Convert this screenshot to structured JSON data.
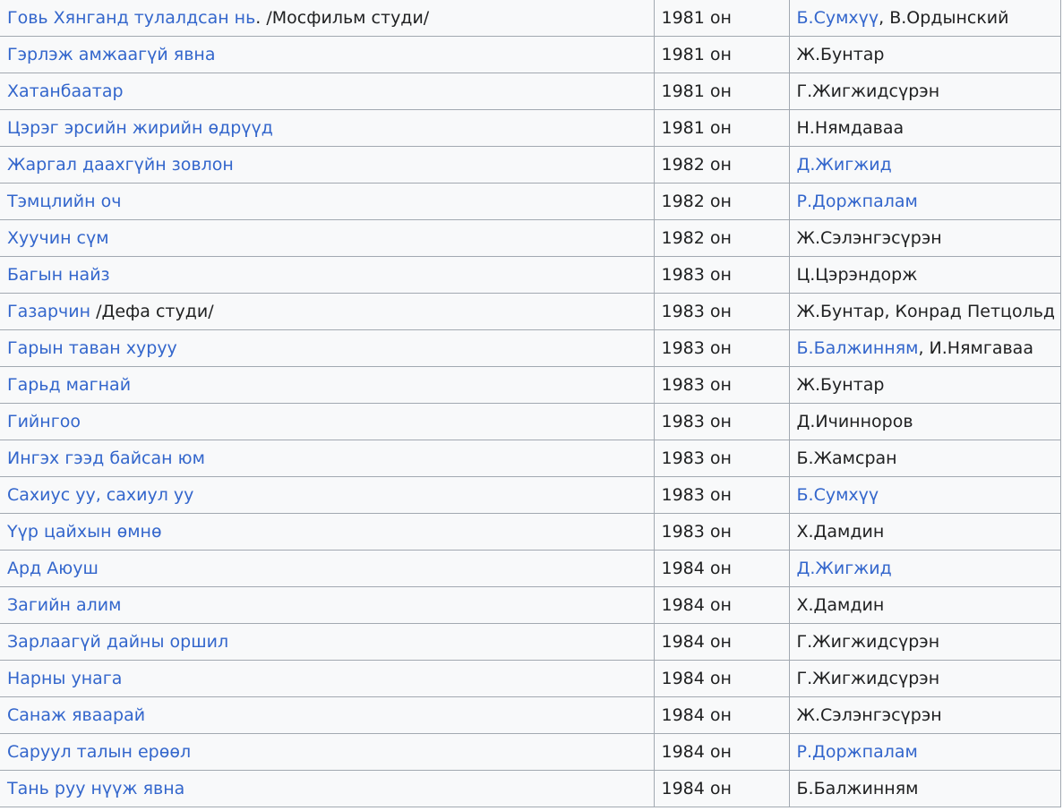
{
  "films": [
    {
      "title": [
        {
          "text": "Говь Хянганд тулалдсан нь",
          "link": true
        },
        {
          "text": ". /Мосфильм студи/",
          "link": false
        }
      ],
      "year": "1981 он",
      "director": [
        {
          "text": "Б.Сумхүү",
          "link": true
        },
        {
          "text": ", В.Ордынский",
          "link": false
        }
      ]
    },
    {
      "title": [
        {
          "text": "Гэрлэж амжаагүй явна",
          "link": true
        }
      ],
      "year": "1981 он",
      "director": [
        {
          "text": "Ж.Бунтар",
          "link": false
        }
      ]
    },
    {
      "title": [
        {
          "text": "Хатанбаатар",
          "link": true
        }
      ],
      "year": "1981 он",
      "director": [
        {
          "text": "Г.Жигжидсүрэн",
          "link": false
        }
      ]
    },
    {
      "title": [
        {
          "text": "Цэрэг эрсийн жирийн өдрүүд",
          "link": true
        }
      ],
      "year": "1981 он",
      "director": [
        {
          "text": "Н.Нямдаваа",
          "link": false
        }
      ]
    },
    {
      "title": [
        {
          "text": "Жаргал даахгүйн зовлон",
          "link": true
        }
      ],
      "year": "1982 он",
      "director": [
        {
          "text": "Д.Жигжид",
          "link": true
        }
      ]
    },
    {
      "title": [
        {
          "text": "Тэмцлийн оч",
          "link": true
        }
      ],
      "year": "1982 он",
      "director": [
        {
          "text": "Р.Доржпалам",
          "link": true
        }
      ]
    },
    {
      "title": [
        {
          "text": "Хуучин сүм",
          "link": true
        }
      ],
      "year": "1982 он",
      "director": [
        {
          "text": "Ж.Сэлэнгэсүрэн",
          "link": false
        }
      ]
    },
    {
      "title": [
        {
          "text": "Багын найз",
          "link": true
        }
      ],
      "year": "1983 он",
      "director": [
        {
          "text": "Ц.Цэрэндорж",
          "link": false
        }
      ]
    },
    {
      "title": [
        {
          "text": "Газарчин",
          "link": true
        },
        {
          "text": " /Дефа студи/",
          "link": false
        }
      ],
      "year": "1983 он",
      "director": [
        {
          "text": "Ж.Бунтар, Конрад Петцольд",
          "link": false
        }
      ]
    },
    {
      "title": [
        {
          "text": "Гарын таван хуруу",
          "link": true
        }
      ],
      "year": "1983 он",
      "director": [
        {
          "text": "Б.Балжинням",
          "link": true
        },
        {
          "text": ", И.Нямгаваа",
          "link": false
        }
      ]
    },
    {
      "title": [
        {
          "text": "Гарьд магнай",
          "link": true
        }
      ],
      "year": "1983 он",
      "director": [
        {
          "text": "Ж.Бунтар",
          "link": false
        }
      ]
    },
    {
      "title": [
        {
          "text": "Гийнгоо",
          "link": true
        }
      ],
      "year": "1983 он",
      "director": [
        {
          "text": "Д.Ичинноров",
          "link": false
        }
      ]
    },
    {
      "title": [
        {
          "text": "Ингэх гээд байсан юм",
          "link": true
        }
      ],
      "year": "1983 он",
      "director": [
        {
          "text": "Б.Жамсран",
          "link": false
        }
      ]
    },
    {
      "title": [
        {
          "text": "Сахиус уу, сахиул уу",
          "link": true
        }
      ],
      "year": "1983 он",
      "director": [
        {
          "text": "Б.Сумхүү",
          "link": true
        }
      ]
    },
    {
      "title": [
        {
          "text": "Үүр цайхын өмнө",
          "link": true
        }
      ],
      "year": "1983 он",
      "director": [
        {
          "text": "Х.Дамдин",
          "link": false
        }
      ]
    },
    {
      "title": [
        {
          "text": "Ард Аюуш",
          "link": true
        }
      ],
      "year": "1984 он",
      "director": [
        {
          "text": "Д.Жигжид",
          "link": true
        }
      ]
    },
    {
      "title": [
        {
          "text": "Загийн алим",
          "link": true
        }
      ],
      "year": "1984 он",
      "director": [
        {
          "text": "Х.Дамдин",
          "link": false
        }
      ]
    },
    {
      "title": [
        {
          "text": "Зарлаагүй дайны оршил",
          "link": true
        }
      ],
      "year": "1984 он",
      "director": [
        {
          "text": "Г.Жигжидсүрэн",
          "link": false
        }
      ]
    },
    {
      "title": [
        {
          "text": "Нарны унага",
          "link": true
        }
      ],
      "year": "1984 он",
      "director": [
        {
          "text": "Г.Жигжидсүрэн",
          "link": false
        }
      ]
    },
    {
      "title": [
        {
          "text": "Санаж яваарай",
          "link": true
        }
      ],
      "year": "1984 он",
      "director": [
        {
          "text": "Ж.Сэлэнгэсүрэн",
          "link": false
        }
      ]
    },
    {
      "title": [
        {
          "text": "Саруул талын ерөөл",
          "link": true
        }
      ],
      "year": "1984 он",
      "director": [
        {
          "text": "Р.Доржпалам",
          "link": true
        }
      ]
    },
    {
      "title": [
        {
          "text": "Тань руу нүүж явна",
          "link": true
        }
      ],
      "year": "1984 он",
      "director": [
        {
          "text": "Б.Балжинням",
          "link": false
        }
      ]
    }
  ],
  "colors": {
    "link": "#3366cc",
    "text": "#202122",
    "border": "#a2a9b1",
    "cell_bg": "#f8f9fa"
  }
}
